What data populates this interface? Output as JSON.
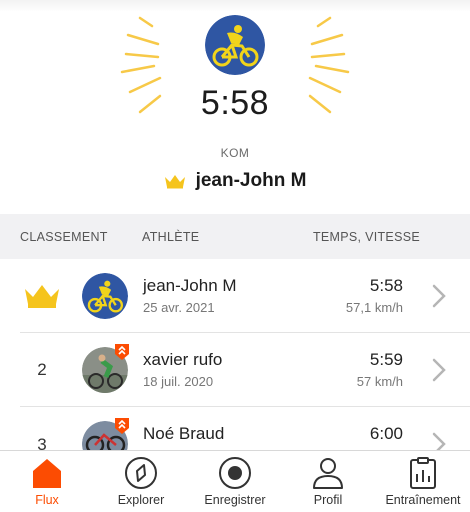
{
  "colors": {
    "accent": "#fc4c02",
    "crown": "#f5c41d",
    "rays": "#f7c948",
    "avatar_bg": "#2f56a3",
    "avatar_rider": "#f2d41a"
  },
  "hero": {
    "time": "5:58",
    "badge": "KOM",
    "holder_name": "jean-John M",
    "crown_icon": "crown-icon",
    "avatar_icon": "cyclist-avatar"
  },
  "table": {
    "headers": {
      "rank": "CLASSEMENT",
      "athlete": "ATHLÈTE",
      "time": "TEMPS, VITESSE"
    },
    "rows": [
      {
        "rank": "",
        "rank_icon": "crown-icon",
        "name": "jean-John M",
        "date": "25 avr. 2021",
        "time": "5:58",
        "speed": "57,1 km/h",
        "badge": false
      },
      {
        "rank": "2",
        "name": "xavier rufo",
        "date": "18 juil. 2020",
        "time": "5:59",
        "speed": "57 km/h",
        "badge": true
      },
      {
        "rank": "3",
        "name": "Noé Braud",
        "date": "",
        "time": "6:00",
        "speed": "",
        "badge": true
      }
    ]
  },
  "nav": {
    "items": [
      {
        "label": "Flux",
        "icon": "home-icon",
        "active": true
      },
      {
        "label": "Explorer",
        "icon": "compass-icon",
        "active": false
      },
      {
        "label": "Enregistrer",
        "icon": "record-icon",
        "active": false
      },
      {
        "label": "Profil",
        "icon": "profile-icon",
        "active": false
      },
      {
        "label": "Entraînement",
        "icon": "training-icon",
        "active": false
      }
    ]
  }
}
